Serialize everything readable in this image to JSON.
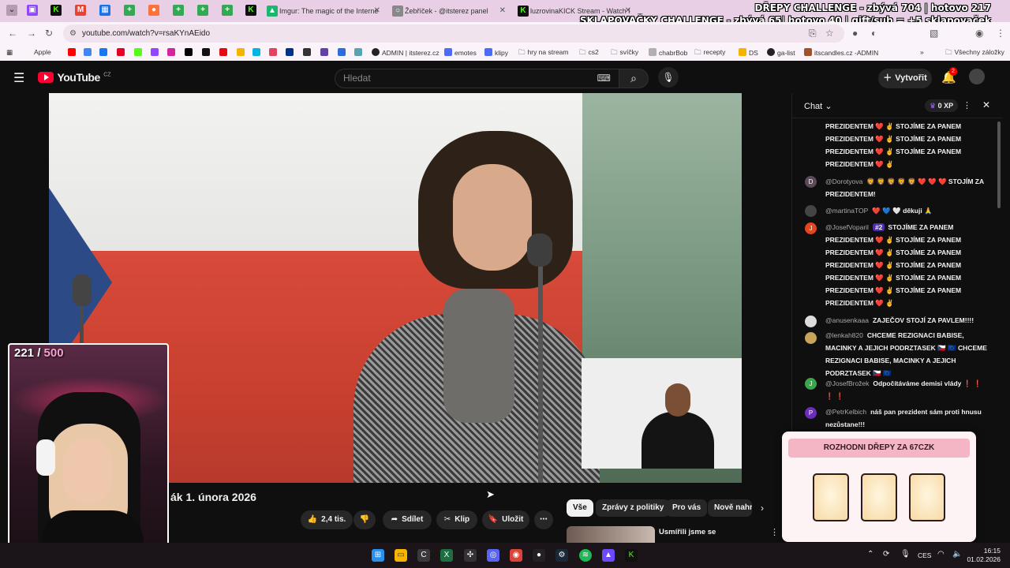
{
  "browser": {
    "tabs": [
      {
        "label": "Imgur: The magic of the Interne"
      },
      {
        "label": "Žebříček - @itsterez panel"
      },
      {
        "label": "luzrovinaKICK Stream - Watch l"
      }
    ],
    "url": "youtube.com/watch?v=rsaKYnAEido",
    "bookmarks": [
      "Apple",
      "ADMIN | itsterez.cz",
      "emotes",
      "klipy",
      "hry na stream",
      "cs2",
      "svíčky",
      "chabrBob",
      "recepty",
      "DS",
      "ga-list",
      "itscandles.cz -ADMIN",
      "Všechny záložky"
    ]
  },
  "overlay": {
    "line1": "DŘEPY CHALLENGE - zbývá 704 | hotovo 217",
    "line2": "SKLAPOVAČKY CHALLENGE - zbývá 65| hotovo 40 | gift/sub = +5 sklapovaček"
  },
  "youtube": {
    "logo": "YouTube",
    "region": "CZ",
    "search_placeholder": "Hledat",
    "create_label": "Vytvořit",
    "notif_count": "2"
  },
  "video": {
    "title": "ák 1. února 2026",
    "likes": "2,4 tis.",
    "share": "Sdílet",
    "clip": "Klip",
    "save": "Uložit"
  },
  "chips": [
    "Vše",
    "Zprávy z politiky",
    "Pro vás",
    "Nově nahr"
  ],
  "recommendation": {
    "title": "Usmířili jsme se"
  },
  "webcam": {
    "count": "221",
    "separator": "/",
    "goal": "500"
  },
  "chat": {
    "title": "Chat",
    "xp": "0 XP",
    "messages": [
      {
        "text": "PREZIDENTEM ❤️ ✌️ STOJÍME ZA PANEM"
      },
      {
        "text": "PREZIDENTEM ❤️ ✌️ STOJÍME ZA PANEM"
      },
      {
        "text": "PREZIDENTEM ❤️ ✌️ STOJÍME ZA PANEM"
      },
      {
        "text": "PREZIDENTEM ❤️ ✌️"
      },
      {
        "author": "@Dorotyova",
        "text": "🦁 🦁 🦁 🦁 🦁 ❤️ ❤️ ❤️ STOJÍM ZA PREZIDENTEM!"
      },
      {
        "author": "@martinaTOP",
        "text": "❤️ 💙 🤍 děkuji 🙏"
      },
      {
        "author": "@JosefVoparil",
        "badge": "#2",
        "text": "STOJÍME ZA PANEM PREZIDENTEM ❤️ ✌️ STOJÍME ZA PANEM PREZIDENTEM ❤️ ✌️ STOJÍME ZA PANEM PREZIDENTEM ❤️ ✌️ STOJÍME ZA PANEM PREZIDENTEM ❤️ ✌️ STOJÍME ZA PANEM PREZIDENTEM ❤️ ✌️ STOJÍME ZA PANEM PREZIDENTEM ❤️ ✌️"
      },
      {
        "author": "@anusenkaaa",
        "text": "ZAJEČOV STOJÍ ZA PAVLEM!!!!"
      },
      {
        "author": "@lenkah820",
        "text": "CHCEME REZIGNACI BABISE, MACINKY A JEJICH PODRZTASEK 🇨🇿 🇪🇺 CHCEME REZIGNACI BABISE, MACINKY A JEJICH PODRZTASEK 🇨🇿 🇪🇺"
      },
      {
        "author": "@JosefBrožek",
        "text": "Odpočítáváme demisi vlády ❗ ❗ ❗ ❗"
      },
      {
        "author": "@PetrKelbich",
        "text": "náš pan prezident sám proti hnusu nezůstane!!!"
      }
    ]
  },
  "popup": {
    "title": "ROZHODNI DŘEPY ZA 67CZK"
  },
  "taskbar": {
    "lang": "CES",
    "time": "16:15",
    "date": "01.02.2026"
  },
  "colors": {
    "accent": "#ff0033",
    "popup_bar": "#f4b6c4",
    "overlay_text": "#ffffff"
  }
}
